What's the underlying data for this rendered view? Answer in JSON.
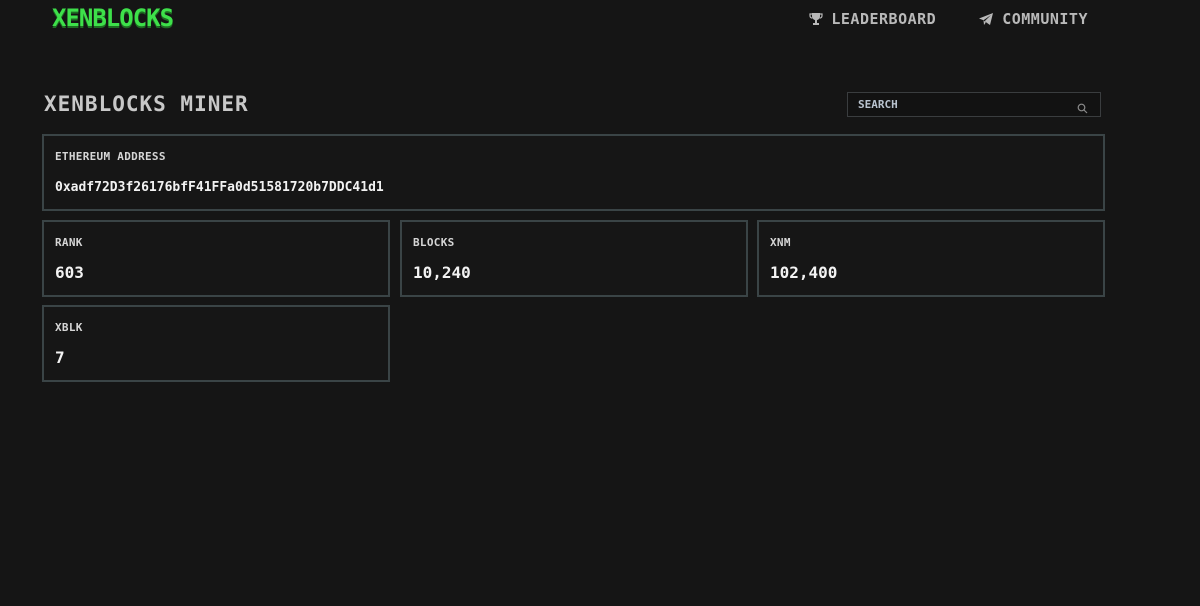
{
  "header": {
    "logo": "XENBLOCKS",
    "nav": [
      {
        "label": "LEADERBOARD",
        "icon": "trophy-icon"
      },
      {
        "label": "COMMUNITY",
        "icon": "paper-plane-icon"
      }
    ]
  },
  "page": {
    "title": "XENBLOCKS MINER"
  },
  "search": {
    "placeholder": "SEARCH",
    "icon": "search-icon"
  },
  "address_card": {
    "label": "ETHEREUM ADDRESS",
    "value": "0xadf72D3f26176bfF41FFa0d51581720b7DDC41d1"
  },
  "stats": [
    {
      "label": "RANK",
      "value": "603"
    },
    {
      "label": "BLOCKS",
      "value": "10,240"
    },
    {
      "label": "XNM",
      "value": "102,400"
    },
    {
      "label": "XBLK",
      "value": "7"
    }
  ],
  "colors": {
    "background": "#151515",
    "logo": "#3ee04a",
    "card_border": "#3a4446"
  }
}
